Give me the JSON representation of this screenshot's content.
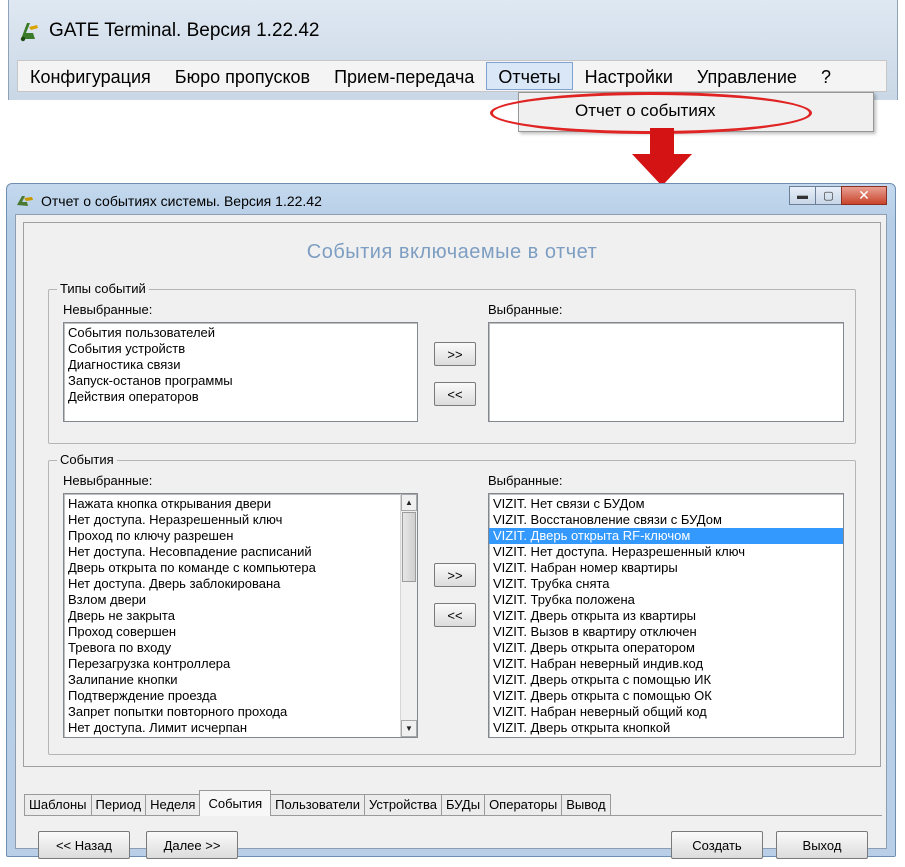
{
  "app": {
    "title": "GATE Terminal.  Версия 1.22.42",
    "menu": [
      {
        "label": "Конфигурация",
        "open": false
      },
      {
        "label": "Бюро пропусков",
        "open": false
      },
      {
        "label": "Прием-передача",
        "open": false
      },
      {
        "label": "Отчеты",
        "open": true
      },
      {
        "label": "Настройки",
        "open": false
      },
      {
        "label": "Управление",
        "open": false
      },
      {
        "label": "?",
        "open": false
      }
    ],
    "dropdown_item": "Отчет о событиях",
    "highlight_color": "#e02323"
  },
  "report": {
    "title": "Отчет о событиях системы.  Версия 1.22.42",
    "heading": "События включаемые в отчет",
    "heading_color": "#7d9ec2",
    "types": {
      "legend": "Типы событий",
      "unselected_label": "Невыбранные:",
      "selected_label": "Выбранные:",
      "unselected": [
        "События пользователей",
        "События устройств",
        "Диагностика связи",
        "Запуск-останов программы",
        "Действия операторов"
      ],
      "selected": [],
      "add_label": ">>",
      "remove_label": "<<"
    },
    "events": {
      "legend": "События",
      "unselected_label": "Невыбранные:",
      "selected_label": "Выбранные:",
      "unselected": [
        "Нажата кнопка открывания двери",
        "Нет доступа. Неразрешенный ключ",
        "Проход по ключу разрешен",
        "Нет доступа. Несовпадение расписаний",
        "Дверь открыта по команде с компьютера",
        "Нет доступа. Дверь заблокирована",
        "Взлом двери",
        "Дверь не закрыта",
        "Проход совершен",
        "Тревога по входу",
        "Перезагрузка контроллера",
        "Залипание кнопки",
        "Подтверждение проезда",
        "Запрет попытки повторного прохода",
        "Нет доступа. Лимит исчерпан"
      ],
      "selected": [
        "VIZIT. Нет связи с БУДом",
        "VIZIT. Восстановление связи с БУДом",
        "VIZIT. Дверь открыта RF-ключом",
        "VIZIT. Нет доступа. Неразрешенный ключ",
        "VIZIT. Набран номер квартиры",
        "VIZIT. Трубка снята",
        "VIZIT. Трубка положена",
        "VIZIT. Дверь открыта из квартиры",
        "VIZIT. Вызов в квартиру отключен",
        "VIZIT. Дверь открыта оператором",
        "VIZIT. Набран неверный индив.код",
        "VIZIT. Дверь открыта с помощью ИК",
        "VIZIT. Дверь открыта с помощью ОК",
        "VIZIT. Набран неверный общий код",
        "VIZIT. Дверь открыта кнопкой"
      ],
      "selected_highlight": "VIZIT. Дверь открыта RF-ключом",
      "add_label": ">>",
      "remove_label": "<<"
    },
    "tabs": [
      {
        "label": "Шаблоны",
        "active": false
      },
      {
        "label": "Период",
        "active": false
      },
      {
        "label": "Неделя",
        "active": false
      },
      {
        "label": "События",
        "active": true
      },
      {
        "label": "Пользователи",
        "active": false
      },
      {
        "label": "Устройства",
        "active": false
      },
      {
        "label": "БУДы",
        "active": false
      },
      {
        "label": "Операторы",
        "active": false
      },
      {
        "label": "Вывод",
        "active": false
      }
    ],
    "buttons": {
      "back": "<< Назад",
      "next": "Далее >>",
      "create": "Создать",
      "exit": "Выход"
    }
  }
}
